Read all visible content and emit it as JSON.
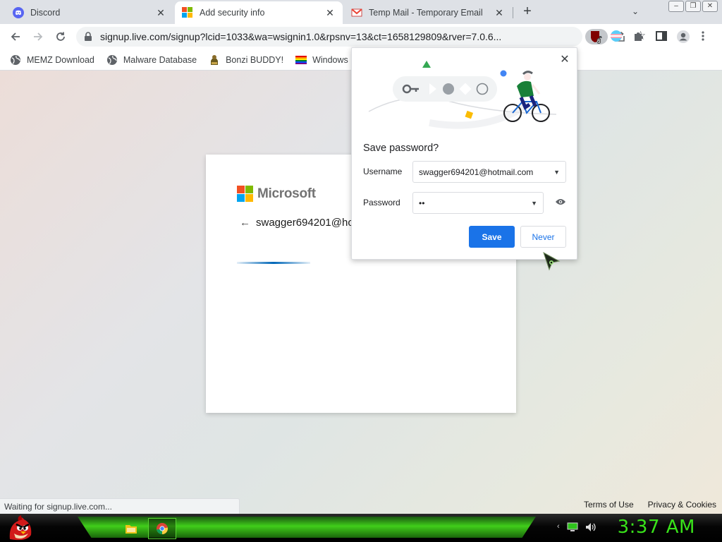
{
  "tabs": [
    {
      "title": "Discord",
      "icon": "discord-icon"
    },
    {
      "title": "Add security info",
      "icon": "microsoft-icon",
      "active": true
    },
    {
      "title": "Temp Mail - Temporary Email",
      "icon": "gmail-icon"
    }
  ],
  "toolbar": {
    "url": "signup.live.com/signup?lcid=1033&wa=wsignin1.0&rpsnv=13&ct=1658129809&rver=7.0.6...",
    "extension_badge": "6"
  },
  "bookmarks": [
    {
      "label": "MEMZ Download",
      "icon": "globe-icon"
    },
    {
      "label": "Malware Database",
      "icon": "globe-icon"
    },
    {
      "label": "Bonzi BUDDY!",
      "icon": "bonzi-icon"
    },
    {
      "label": "Windows ISOs",
      "icon": "windows-flag-icon"
    }
  ],
  "page": {
    "brand": "Microsoft",
    "identity": "swagger694201@hotmail.com",
    "footer": {
      "terms": "Terms of Use",
      "privacy": "Privacy & Cookies"
    },
    "status": "Waiting for signup.live.com..."
  },
  "save_password": {
    "title": "Save password?",
    "username_label": "Username",
    "username_value": "swagger694201@hotmail.com",
    "password_label": "Password",
    "password_value": "••",
    "save_label": "Save",
    "never_label": "Never"
  },
  "taskbar": {
    "clock": "3:37 AM"
  },
  "colors": {
    "accent_blue": "#1a73e8",
    "taskbar_green": "#39e21a",
    "ms_red": "#f25022",
    "ms_green": "#7fba00",
    "ms_blue": "#00a4ef",
    "ms_yellow": "#ffb900"
  }
}
